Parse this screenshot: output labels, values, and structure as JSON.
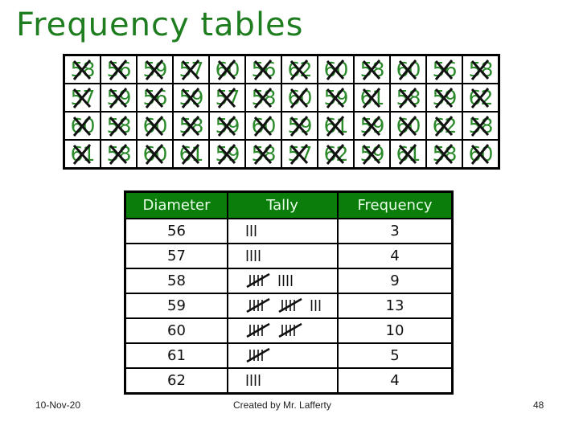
{
  "title": "Frequency tables",
  "raw_data": {
    "rows": [
      [
        58,
        56,
        59,
        57,
        60,
        56,
        62,
        60,
        58,
        60,
        56,
        58
      ],
      [
        57,
        59,
        56,
        59,
        57,
        58,
        60,
        59,
        61,
        58,
        59,
        62
      ],
      [
        60,
        58,
        60,
        58,
        59,
        60,
        59,
        61,
        59,
        60,
        62,
        58
      ],
      [
        61,
        58,
        60,
        61,
        59,
        58,
        57,
        62,
        59,
        61,
        58,
        60
      ]
    ],
    "all_crossed_out": true
  },
  "frequency_table": {
    "headers": [
      "Diameter",
      "Tally",
      "Frequency"
    ],
    "rows": [
      {
        "diameter": "56",
        "tally": 3,
        "frequency": "3"
      },
      {
        "diameter": "57",
        "tally": 4,
        "frequency": "4"
      },
      {
        "diameter": "58",
        "tally": 9,
        "frequency": "9"
      },
      {
        "diameter": "59",
        "tally": 13,
        "frequency": "13"
      },
      {
        "diameter": "60",
        "tally": 10,
        "frequency": "10"
      },
      {
        "diameter": "61",
        "tally": 5,
        "frequency": "5"
      },
      {
        "diameter": "62",
        "tally": 4,
        "frequency": "4"
      }
    ]
  },
  "footer": {
    "date": "10-Nov-20",
    "credit": "Created by Mr. Lafferty",
    "page": "48"
  },
  "colors": {
    "title": "#1e7d1e",
    "header_bg": "#0b7d0b",
    "digit": "#2a8a2a"
  }
}
